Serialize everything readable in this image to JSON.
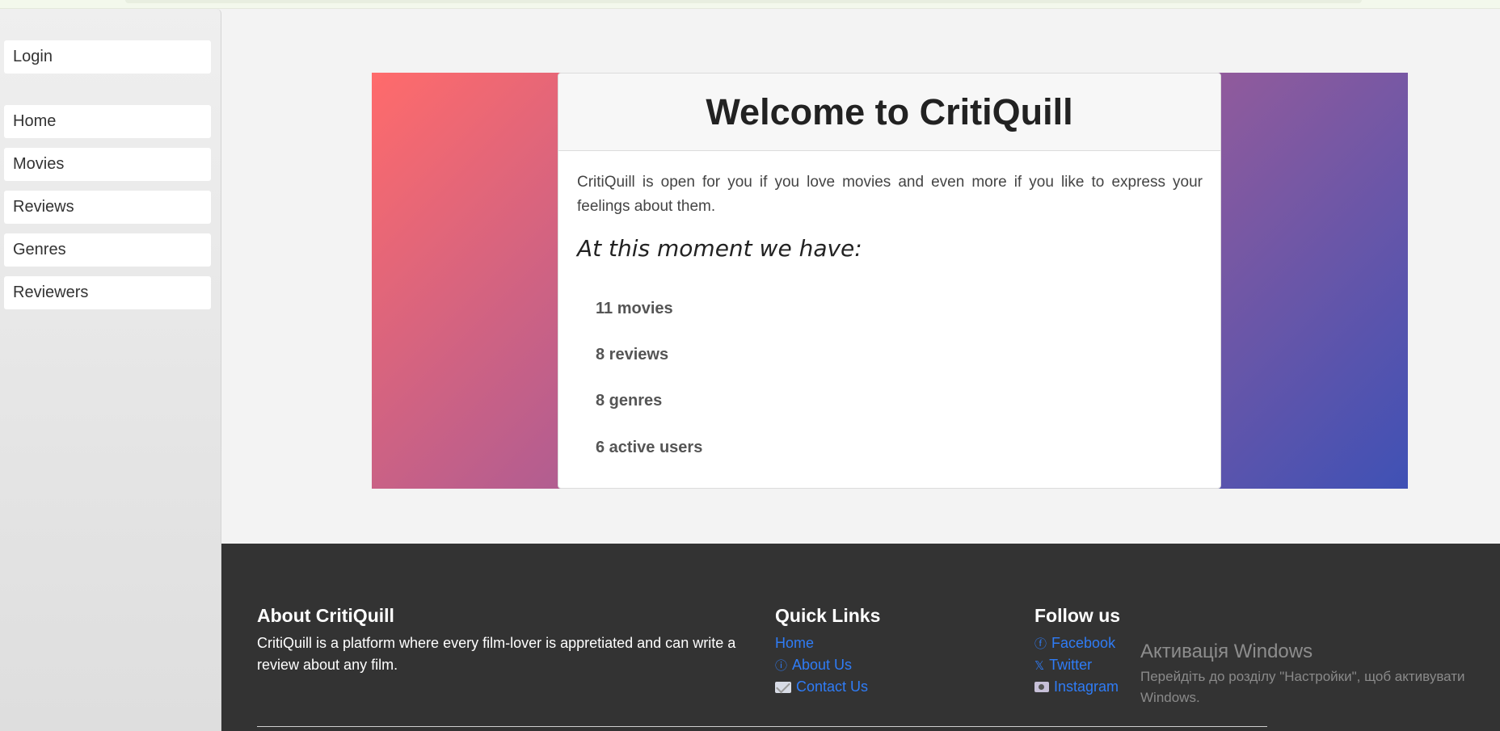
{
  "sidebar": {
    "login_label": "Login",
    "items": [
      {
        "label": "Home"
      },
      {
        "label": "Movies"
      },
      {
        "label": "Reviews"
      },
      {
        "label": "Genres"
      },
      {
        "label": "Reviewers"
      }
    ]
  },
  "welcome": {
    "title": "Welcome to CritiQuill",
    "intro": "CritiQuill is open for you if you love movies and even more if you like to express your feelings about them.",
    "moment": "At this moment we have:",
    "stats": [
      "11 movies",
      "8 reviews",
      "8 genres",
      "6 active users"
    ]
  },
  "footer": {
    "about_title": "About CritiQuill",
    "about_text": "CritiQuill is a platform where every film-lover is appretiated and can write a review about any film.",
    "quick_title": "Quick Links",
    "quick_links": [
      {
        "icon": "none",
        "label": "Home"
      },
      {
        "icon": "info-icon",
        "glyph": "ⓘ",
        "label": "About Us"
      },
      {
        "icon": "mail-icon",
        "label": "Contact Us"
      }
    ],
    "follow_title": "Follow us",
    "follow_links": [
      {
        "icon": "facebook-icon",
        "glyph": "ⓕ",
        "label": "Facebook"
      },
      {
        "icon": "x-icon",
        "glyph": "𝕏",
        "label": "Twitter"
      },
      {
        "icon": "camera-icon",
        "label": "Instagram"
      }
    ]
  },
  "watermark": {
    "title": "Активація Windows",
    "subtitle": "Перейдіть до розділу \"Настройки\", щоб активувати Windows."
  },
  "colors": {
    "link": "#2f7cf6",
    "footer_bg": "#333333",
    "hero_gradient_start": "#ff6b6b",
    "hero_gradient_end": "#3f51b5"
  }
}
